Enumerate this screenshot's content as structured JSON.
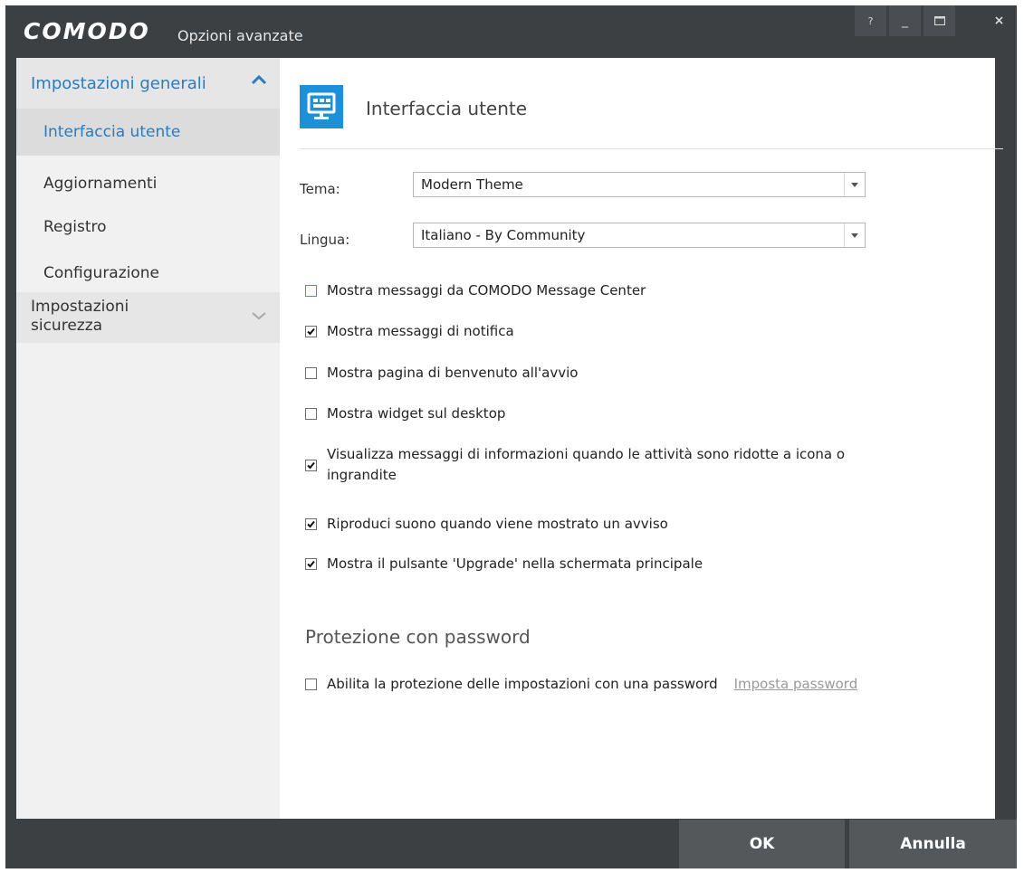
{
  "window": {
    "brand": "COMODO",
    "title": "Opzioni avanzate",
    "help_glyph": "?",
    "minimize_glyph": "_",
    "close_glyph": "×"
  },
  "sidebar": {
    "general_label": "Impostazioni generali",
    "items": [
      {
        "label": "Interfaccia utente",
        "active": true
      },
      {
        "label": "Aggiornamenti"
      },
      {
        "label": "Registro"
      },
      {
        "label": "Configurazione"
      }
    ],
    "security_label_1": "Impostazioni",
    "security_label_2": "sicurezza"
  },
  "main": {
    "section_title": "Interfaccia utente",
    "theme_label": "Tema:",
    "theme_value": "Modern Theme",
    "language_label": "Lingua:",
    "language_value": "Italiano - By Community",
    "checkboxes": [
      {
        "label": "Mostra messaggi da COMODO Message Center",
        "checked": false
      },
      {
        "label": "Mostra messaggi di notifica",
        "checked": true
      },
      {
        "label": "Mostra pagina di benvenuto all'avvio",
        "checked": false
      },
      {
        "label": "Mostra widget sul desktop",
        "checked": false
      },
      {
        "label_1": "Visualizza messaggi di informazioni quando le attività sono ridotte a icona o",
        "label_2": "ingrandite",
        "checked": true
      },
      {
        "label": "Riproduci suono quando viene mostrato un avviso",
        "checked": true
      },
      {
        "label": "Mostra il pulsante 'Upgrade' nella schermata principale",
        "checked": true
      }
    ],
    "password_heading": "Protezione con password",
    "password_checkbox_label": "Abilita la protezione delle impostazioni con una password",
    "password_link": "Imposta password"
  },
  "footer": {
    "ok_label": "OK",
    "cancel_label": "Annulla"
  },
  "colors": {
    "accent": "#2a7bbf",
    "icon_bg": "#1e90d8",
    "chrome": "#3d4043"
  },
  "icons": [
    "monitor-icon",
    "chevron-up-icon",
    "chevron-down-icon",
    "dropdown-arrow-icon",
    "checkmark-icon"
  ]
}
